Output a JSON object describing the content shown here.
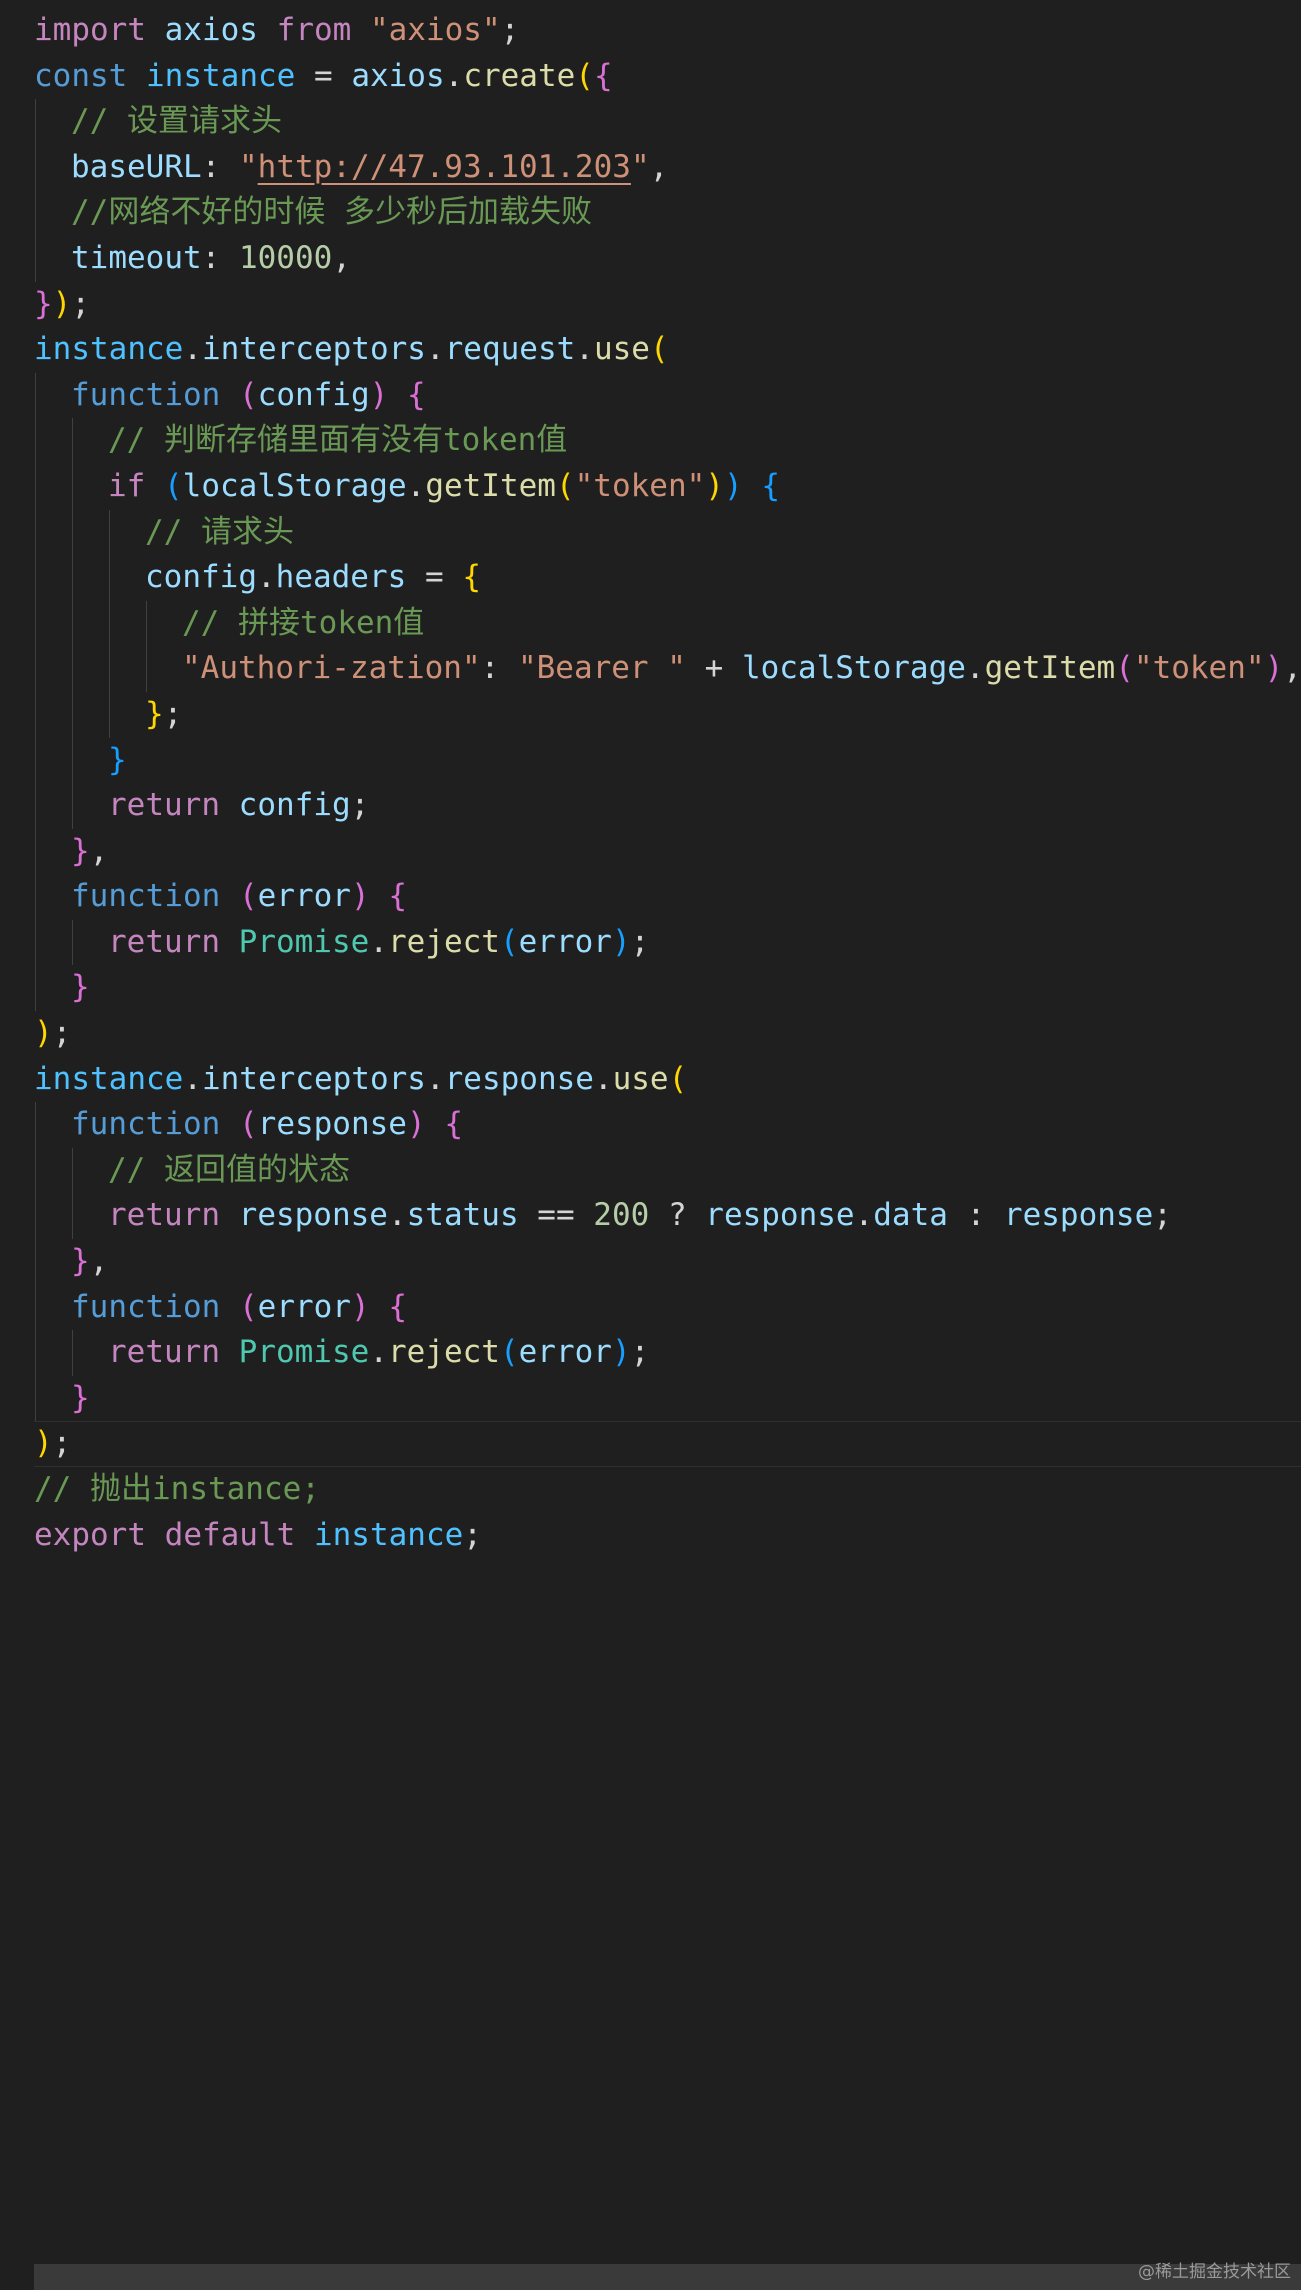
{
  "editor": {
    "colors": {
      "background": "#1f1f1f",
      "keyword_control": "#c586c0",
      "keyword_storage": "#569cd6",
      "variable": "#9cdcfe",
      "function": "#dcdcaa",
      "string": "#ce9178",
      "comment": "#6a9955",
      "number": "#b5cea8",
      "class": "#4ec9b0",
      "default_text": "#d4d4d4",
      "bracket_gold": "#ffd700",
      "bracket_pink": "#da70d6",
      "bracket_blue": "#179fff"
    },
    "lines": [
      {
        "indent": 0,
        "tokens": [
          {
            "t": "import",
            "c": "#c586c0"
          },
          {
            "t": " "
          },
          {
            "t": "axios",
            "c": "#9cdcfe"
          },
          {
            "t": " "
          },
          {
            "t": "from",
            "c": "#c586c0"
          },
          {
            "t": " "
          },
          {
            "t": "\"axios\"",
            "c": "#ce9178"
          },
          {
            "t": ";"
          }
        ]
      },
      {
        "indent": 0,
        "tokens": [
          {
            "t": "const",
            "c": "#569cd6"
          },
          {
            "t": " "
          },
          {
            "t": "instance",
            "c": "#4fc1ff"
          },
          {
            "t": " = "
          },
          {
            "t": "axios",
            "c": "#9cdcfe"
          },
          {
            "t": "."
          },
          {
            "t": "create",
            "c": "#dcdcaa"
          },
          {
            "t": "(",
            "c": "#ffd700"
          },
          {
            "t": "{",
            "c": "#da70d6"
          }
        ]
      },
      {
        "indent": 1,
        "tokens": [
          {
            "t": "// 设置请求头",
            "c": "#6a9955"
          }
        ]
      },
      {
        "indent": 1,
        "tokens": [
          {
            "t": "baseURL",
            "c": "#9cdcfe"
          },
          {
            "t": ": "
          },
          {
            "t": "\"",
            "c": "#ce9178"
          },
          {
            "t": "http://47.93.101.203",
            "c": "#ce9178",
            "u": true
          },
          {
            "t": "\"",
            "c": "#ce9178"
          },
          {
            "t": ","
          }
        ]
      },
      {
        "indent": 1,
        "tokens": [
          {
            "t": "//网络不好的时候 多少秒后加载失败",
            "c": "#6a9955"
          }
        ]
      },
      {
        "indent": 1,
        "tokens": [
          {
            "t": "timeout",
            "c": "#9cdcfe"
          },
          {
            "t": ": "
          },
          {
            "t": "10000",
            "c": "#b5cea8"
          },
          {
            "t": ","
          }
        ]
      },
      {
        "indent": 0,
        "tokens": [
          {
            "t": "}",
            "c": "#da70d6"
          },
          {
            "t": ")",
            "c": "#ffd700"
          },
          {
            "t": ";"
          }
        ]
      },
      {
        "indent": 0,
        "tokens": [
          {
            "t": "instance",
            "c": "#4fc1ff"
          },
          {
            "t": "."
          },
          {
            "t": "interceptors",
            "c": "#9cdcfe"
          },
          {
            "t": "."
          },
          {
            "t": "request",
            "c": "#9cdcfe"
          },
          {
            "t": "."
          },
          {
            "t": "use",
            "c": "#dcdcaa"
          },
          {
            "t": "(",
            "c": "#ffd700"
          }
        ]
      },
      {
        "indent": 1,
        "tokens": [
          {
            "t": "function",
            "c": "#569cd6"
          },
          {
            "t": " "
          },
          {
            "t": "(",
            "c": "#da70d6"
          },
          {
            "t": "config",
            "c": "#9cdcfe"
          },
          {
            "t": ")",
            "c": "#da70d6"
          },
          {
            "t": " "
          },
          {
            "t": "{",
            "c": "#da70d6"
          }
        ]
      },
      {
        "indent": 2,
        "tokens": [
          {
            "t": "// 判断存储里面有没有token值",
            "c": "#6a9955"
          }
        ]
      },
      {
        "indent": 2,
        "tokens": [
          {
            "t": "if",
            "c": "#c586c0"
          },
          {
            "t": " "
          },
          {
            "t": "(",
            "c": "#179fff"
          },
          {
            "t": "localStorage",
            "c": "#9cdcfe"
          },
          {
            "t": "."
          },
          {
            "t": "getItem",
            "c": "#dcdcaa"
          },
          {
            "t": "(",
            "c": "#ffd700"
          },
          {
            "t": "\"token\"",
            "c": "#ce9178"
          },
          {
            "t": ")",
            "c": "#ffd700"
          },
          {
            "t": ")",
            "c": "#179fff"
          },
          {
            "t": " "
          },
          {
            "t": "{",
            "c": "#179fff"
          }
        ]
      },
      {
        "indent": 3,
        "tokens": [
          {
            "t": "// 请求头",
            "c": "#6a9955"
          }
        ]
      },
      {
        "indent": 3,
        "tokens": [
          {
            "t": "config",
            "c": "#9cdcfe"
          },
          {
            "t": "."
          },
          {
            "t": "headers",
            "c": "#9cdcfe"
          },
          {
            "t": " = "
          },
          {
            "t": "{",
            "c": "#ffd700"
          }
        ]
      },
      {
        "indent": 4,
        "tokens": [
          {
            "t": "// 拼接token值",
            "c": "#6a9955"
          }
        ]
      },
      {
        "indent": 4,
        "tokens": [
          {
            "t": "\"Authori-zation\"",
            "c": "#ce9178"
          },
          {
            "t": ": "
          },
          {
            "t": "\"Bearer \"",
            "c": "#ce9178"
          },
          {
            "t": " + "
          },
          {
            "t": "localStorage",
            "c": "#9cdcfe"
          },
          {
            "t": "."
          },
          {
            "t": "getItem",
            "c": "#dcdcaa"
          },
          {
            "t": "(",
            "c": "#da70d6"
          },
          {
            "t": "\"token\"",
            "c": "#ce9178"
          },
          {
            "t": ")",
            "c": "#da70d6"
          },
          {
            "t": ","
          }
        ]
      },
      {
        "indent": 3,
        "tokens": [
          {
            "t": "}",
            "c": "#ffd700"
          },
          {
            "t": ";"
          }
        ]
      },
      {
        "indent": 2,
        "tokens": [
          {
            "t": "}",
            "c": "#179fff"
          }
        ]
      },
      {
        "indent": 2,
        "tokens": [
          {
            "t": "return",
            "c": "#c586c0"
          },
          {
            "t": " "
          },
          {
            "t": "config",
            "c": "#9cdcfe"
          },
          {
            "t": ";"
          }
        ]
      },
      {
        "indent": 1,
        "tokens": [
          {
            "t": "}",
            "c": "#da70d6"
          },
          {
            "t": ","
          }
        ]
      },
      {
        "indent": 1,
        "tokens": [
          {
            "t": "function",
            "c": "#569cd6"
          },
          {
            "t": " "
          },
          {
            "t": "(",
            "c": "#da70d6"
          },
          {
            "t": "error",
            "c": "#9cdcfe"
          },
          {
            "t": ")",
            "c": "#da70d6"
          },
          {
            "t": " "
          },
          {
            "t": "{",
            "c": "#da70d6"
          }
        ]
      },
      {
        "indent": 2,
        "tokens": [
          {
            "t": "return",
            "c": "#c586c0"
          },
          {
            "t": " "
          },
          {
            "t": "Promise",
            "c": "#4ec9b0"
          },
          {
            "t": "."
          },
          {
            "t": "reject",
            "c": "#dcdcaa"
          },
          {
            "t": "(",
            "c": "#179fff"
          },
          {
            "t": "error",
            "c": "#9cdcfe"
          },
          {
            "t": ")",
            "c": "#179fff"
          },
          {
            "t": ";"
          }
        ]
      },
      {
        "indent": 1,
        "tokens": [
          {
            "t": "}",
            "c": "#da70d6"
          }
        ]
      },
      {
        "indent": 0,
        "tokens": [
          {
            "t": ")",
            "c": "#ffd700"
          },
          {
            "t": ";"
          }
        ]
      },
      {
        "indent": 0,
        "tokens": [
          {
            "t": "instance",
            "c": "#4fc1ff"
          },
          {
            "t": "."
          },
          {
            "t": "interceptors",
            "c": "#9cdcfe"
          },
          {
            "t": "."
          },
          {
            "t": "response",
            "c": "#9cdcfe"
          },
          {
            "t": "."
          },
          {
            "t": "use",
            "c": "#dcdcaa"
          },
          {
            "t": "(",
            "c": "#ffd700"
          }
        ]
      },
      {
        "indent": 1,
        "tokens": [
          {
            "t": "function",
            "c": "#569cd6"
          },
          {
            "t": " "
          },
          {
            "t": "(",
            "c": "#da70d6"
          },
          {
            "t": "response",
            "c": "#9cdcfe"
          },
          {
            "t": ")",
            "c": "#da70d6"
          },
          {
            "t": " "
          },
          {
            "t": "{",
            "c": "#da70d6"
          }
        ]
      },
      {
        "indent": 2,
        "tokens": [
          {
            "t": "// 返回值的状态",
            "c": "#6a9955"
          }
        ]
      },
      {
        "indent": 2,
        "tokens": [
          {
            "t": "return",
            "c": "#c586c0"
          },
          {
            "t": " "
          },
          {
            "t": "response",
            "c": "#9cdcfe"
          },
          {
            "t": "."
          },
          {
            "t": "status",
            "c": "#9cdcfe"
          },
          {
            "t": " == "
          },
          {
            "t": "200",
            "c": "#b5cea8"
          },
          {
            "t": " ? "
          },
          {
            "t": "response",
            "c": "#9cdcfe"
          },
          {
            "t": "."
          },
          {
            "t": "data",
            "c": "#9cdcfe"
          },
          {
            "t": " : "
          },
          {
            "t": "response",
            "c": "#9cdcfe"
          },
          {
            "t": ";"
          }
        ]
      },
      {
        "indent": 1,
        "tokens": [
          {
            "t": "}",
            "c": "#da70d6"
          },
          {
            "t": ","
          }
        ]
      },
      {
        "indent": 1,
        "tokens": [
          {
            "t": "function",
            "c": "#569cd6"
          },
          {
            "t": " "
          },
          {
            "t": "(",
            "c": "#da70d6"
          },
          {
            "t": "error",
            "c": "#9cdcfe"
          },
          {
            "t": ")",
            "c": "#da70d6"
          },
          {
            "t": " "
          },
          {
            "t": "{",
            "c": "#da70d6"
          }
        ]
      },
      {
        "indent": 2,
        "tokens": [
          {
            "t": "return",
            "c": "#c586c0"
          },
          {
            "t": " "
          },
          {
            "t": "Promise",
            "c": "#4ec9b0"
          },
          {
            "t": "."
          },
          {
            "t": "reject",
            "c": "#dcdcaa"
          },
          {
            "t": "(",
            "c": "#179fff"
          },
          {
            "t": "error",
            "c": "#9cdcfe"
          },
          {
            "t": ")",
            "c": "#179fff"
          },
          {
            "t": ";"
          }
        ]
      },
      {
        "indent": 1,
        "tokens": [
          {
            "t": "}",
            "c": "#da70d6"
          }
        ]
      },
      {
        "indent": 0,
        "current": true,
        "tokens": [
          {
            "t": ")",
            "c": "#ffd700"
          },
          {
            "t": ";"
          }
        ]
      },
      {
        "indent": 0,
        "tokens": [
          {
            "t": "// 抛出instance;",
            "c": "#6a9955"
          }
        ]
      },
      {
        "indent": 0,
        "tokens": [
          {
            "t": "export",
            "c": "#c586c0"
          },
          {
            "t": " "
          },
          {
            "t": "default",
            "c": "#c586c0"
          },
          {
            "t": " "
          },
          {
            "t": "instance",
            "c": "#4fc1ff"
          },
          {
            "t": ";"
          }
        ]
      }
    ]
  },
  "watermark": "@稀土掘金技术社区"
}
